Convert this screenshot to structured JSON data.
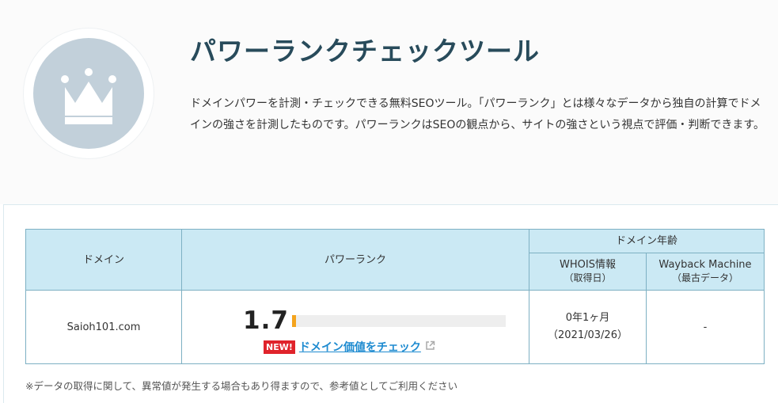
{
  "header": {
    "title": "パワーランクチェックツール",
    "description": "ドメインパワーを計測・チェックできる無料SEOツール。「パワーランク」とは様々なデータから独自の計算でドメインの強さを計測したものです。パワーランクはSEOの観点から、サイトの強さという視点で評価・判断できます。",
    "icon": "crown-icon"
  },
  "table": {
    "headers": {
      "domain": "ドメイン",
      "power_rank": "パワーランク",
      "domain_age": "ドメイン年齢",
      "whois": "WHOIS情報",
      "whois_sub": "（取得日）",
      "wayback": "Wayback Machine",
      "wayback_sub": "（最古データ）"
    },
    "row": {
      "domain": "Saioh101.com",
      "score": "1.7",
      "score_fraction": 0.017,
      "new_label": "NEW!",
      "check_link": "ドメイン価値をチェック",
      "whois_age": "0年1ヶ月",
      "whois_date": "（2021/03/26）",
      "wayback": "-"
    }
  },
  "note": "※データの取得に関して、異常値が発生する場合もあり得ますので、参考値としてご利用ください",
  "colors": {
    "title": "#284b5b",
    "header_bg": "#cbe9f4",
    "border": "#7db0c3",
    "bar_fill": "#f4a41e",
    "new_badge": "#e0232b",
    "link": "#1e8bd0",
    "badge_bg": "#c2d0da"
  }
}
